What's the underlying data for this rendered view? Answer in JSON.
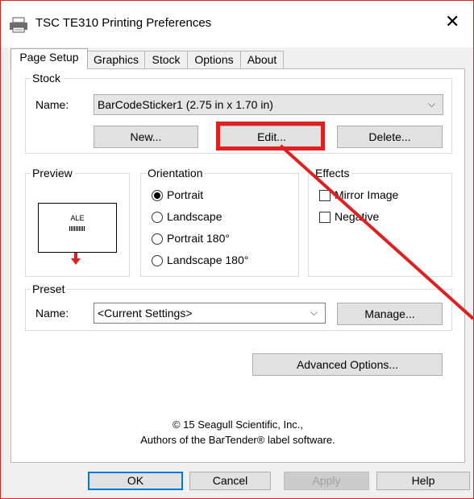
{
  "window": {
    "title": "TSC TE310 Printing Preferences",
    "close_glyph": "✕"
  },
  "tabs": [
    "Page Setup",
    "Graphics",
    "Stock",
    "Options",
    "About"
  ],
  "stock": {
    "group_label": "Stock",
    "name_label": "Name:",
    "name_value": "BarCodeSticker1 (2.75 in x 1.70 in)",
    "new_btn": "New...",
    "edit_btn": "Edit...",
    "delete_btn": "Delete..."
  },
  "preview": {
    "group_label": "Preview",
    "card_text": "ALE"
  },
  "orientation": {
    "group_label": "Orientation",
    "options": [
      "Portrait",
      "Landscape",
      "Portrait 180°",
      "Landscape 180°"
    ],
    "selected": "Portrait"
  },
  "effects": {
    "group_label": "Effects",
    "options": [
      "Mirror Image",
      "Negative"
    ]
  },
  "preset": {
    "group_label": "Preset",
    "name_label": "Name:",
    "name_value": "<Current Settings>",
    "manage_btn": "Manage..."
  },
  "advanced_btn": "Advanced Options...",
  "copyright": {
    "line1": "© 15 Seagull Scientific, Inc.,",
    "line2": "Authors of the BarTender® label software."
  },
  "footer": {
    "ok": "OK",
    "cancel": "Cancel",
    "apply": "Apply",
    "help": "Help"
  },
  "colors": {
    "annotation": "#e02020",
    "focus": "#0078d7"
  }
}
